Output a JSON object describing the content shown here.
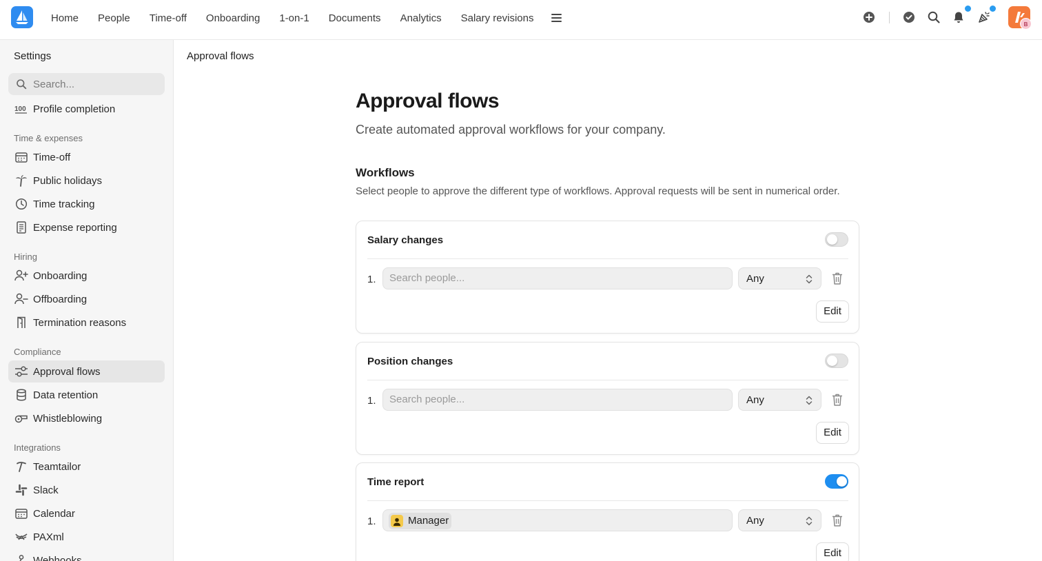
{
  "topbar": {
    "nav": [
      "Home",
      "People",
      "Time-off",
      "Onboarding",
      "1-on-1",
      "Documents",
      "Analytics",
      "Salary revisions"
    ],
    "avatar_badge": "B"
  },
  "sidebar": {
    "title": "Settings",
    "search_placeholder": "Search...",
    "profile_completion": "Profile completion",
    "sections": {
      "time_expenses": "Time & expenses",
      "hiring": "Hiring",
      "compliance": "Compliance",
      "integrations": "Integrations"
    },
    "items": {
      "time_off": "Time-off",
      "public_holidays": "Public holidays",
      "time_tracking": "Time tracking",
      "expense_reporting": "Expense reporting",
      "onboarding": "Onboarding",
      "offboarding": "Offboarding",
      "termination_reasons": "Termination reasons",
      "approval_flows": "Approval flows",
      "data_retention": "Data retention",
      "whistleblowing": "Whistleblowing",
      "teamtailor": "Teamtailor",
      "slack": "Slack",
      "calendar": "Calendar",
      "paxml": "PAXml",
      "webhooks": "Webhooks"
    },
    "active": "approval_flows"
  },
  "main": {
    "breadcrumb": "Approval flows",
    "title": "Approval flows",
    "subtitle": "Create automated approval workflows for your company.",
    "workflows_title": "Workflows",
    "workflows_desc": "Select people to approve the different type of workflows. Approval requests will be sent in numerical order.",
    "cards": [
      {
        "title": "Salary changes",
        "enabled": false,
        "step": "1.",
        "placeholder": "Search people...",
        "select": "Any",
        "edit": "Edit"
      },
      {
        "title": "Position changes",
        "enabled": false,
        "step": "1.",
        "placeholder": "Search people...",
        "select": "Any",
        "edit": "Edit"
      },
      {
        "title": "Time report",
        "enabled": true,
        "step": "1.",
        "chip": "Manager",
        "select": "Any",
        "edit": "Edit"
      }
    ]
  },
  "colors": {
    "accent": "#1e8ef0",
    "brand_logo": "#2f8cf0",
    "avatar": "#f47a3b",
    "notification_dot": "#2a9cf0"
  }
}
